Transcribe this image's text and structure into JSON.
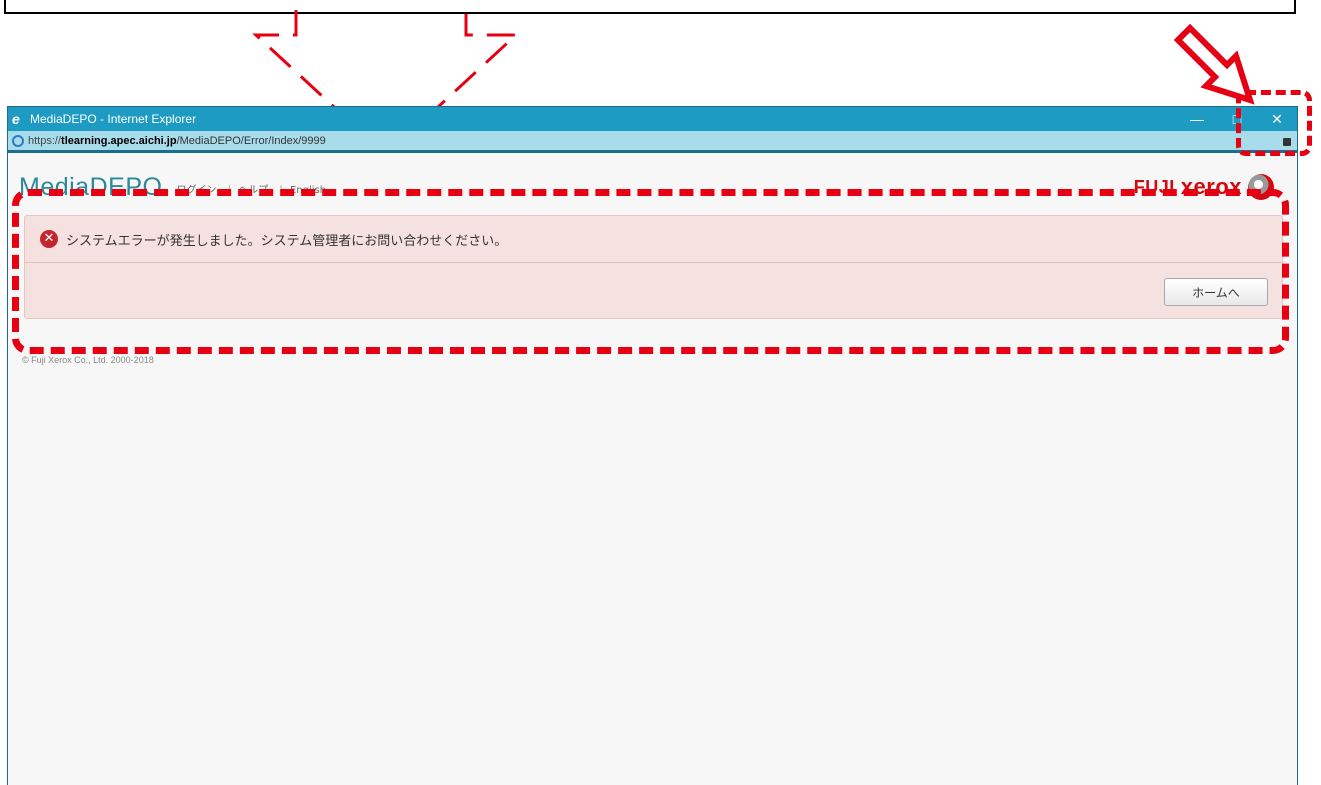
{
  "browser": {
    "window_title": "MediaDEPO - Internet Explorer",
    "address_proto": "https://",
    "address_host": "tlearning.apec.aichi.jp",
    "address_path": "/MediaDEPO/Error/Index/9999",
    "controls": {
      "minimize": "—",
      "maximize": "□",
      "close": "✕"
    }
  },
  "site": {
    "logo": "MediaDEPO",
    "nav": {
      "login": "ログイン",
      "help": "ヘルプ",
      "english": "English"
    },
    "brand": {
      "fuji": "FUJI",
      "xerox": "xerox"
    }
  },
  "alert": {
    "message": "システムエラーが発生しました。システム管理者にお問い合わせください。",
    "home_button": "ホームへ"
  },
  "footer": {
    "copyright": "© Fuji Xerox Co., Ltd. 2000-2018"
  },
  "colors": {
    "annotation": "#e60012",
    "titlebar": "#1e9bc2",
    "alert_bg": "#f5e1df",
    "brand": "#d10a10"
  }
}
